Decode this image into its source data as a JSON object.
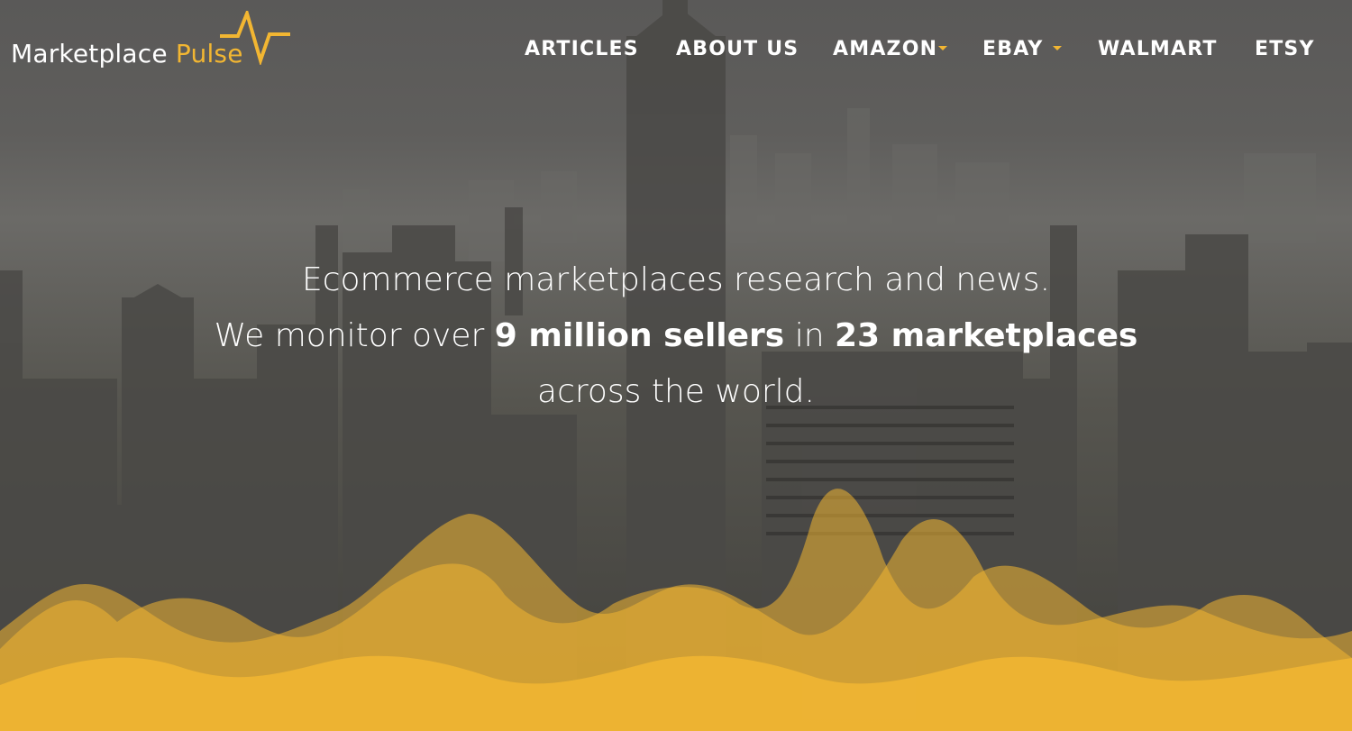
{
  "logo": {
    "text_primary": "Marketplace",
    "text_accent": "Pulse"
  },
  "nav": {
    "items": [
      {
        "label": "ARTICLES",
        "has_dropdown": false
      },
      {
        "label": "ABOUT US",
        "has_dropdown": false
      },
      {
        "label": "AMAZON",
        "has_dropdown": true
      },
      {
        "label": "EBAY",
        "has_dropdown": true
      },
      {
        "label": "WALMART",
        "has_dropdown": false
      },
      {
        "label": "ETSY",
        "has_dropdown": false
      }
    ]
  },
  "hero": {
    "line1": "Ecommerce marketplaces research and news.",
    "line2_pre": "We monitor over",
    "line2_sellers": "9 million sellers",
    "line2_mid": "in",
    "line2_markets": "23 marketplaces",
    "line3": "across the world."
  },
  "colors": {
    "accent": "#f2b632",
    "text": "#ffffff",
    "background": "#5e5d5b"
  }
}
